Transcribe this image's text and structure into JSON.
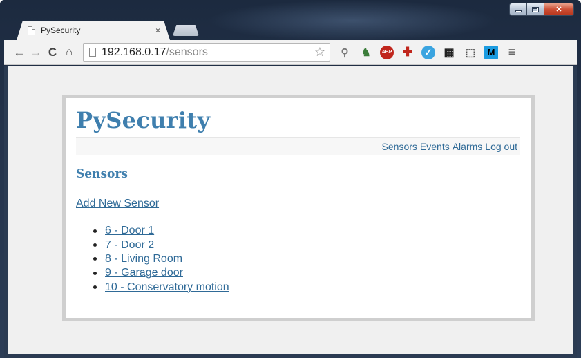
{
  "browser": {
    "tab_title": "PySecurity",
    "tab_close": "×",
    "url_host": "192.168.0.17",
    "url_path": "/sensors",
    "extensions": [
      "search-icon",
      "evernote-icon",
      "adblock-icon",
      "red-cross-icon",
      "vimeo-icon",
      "film-icon",
      "cast-icon",
      "m-icon",
      "menu-icon"
    ],
    "ext_labels": {
      "abp": "ABP",
      "m": "M"
    }
  },
  "site": {
    "title": "PySecurity",
    "nav": [
      {
        "label": "Sensors"
      },
      {
        "label": "Events"
      },
      {
        "label": "Alarms"
      },
      {
        "label": "Log out"
      }
    ]
  },
  "main": {
    "heading": "Sensors",
    "add_link": "Add New Sensor",
    "sensors": [
      {
        "label": "6 - Door 1"
      },
      {
        "label": "7 - Door 2"
      },
      {
        "label": "8 - Living Room"
      },
      {
        "label": "9 - Garage door"
      },
      {
        "label": "10 - Conservatory motion"
      }
    ]
  },
  "colors": {
    "title_blue": "#3f7fae",
    "link_blue": "#2f6a97",
    "frame": "#2b3b52"
  }
}
